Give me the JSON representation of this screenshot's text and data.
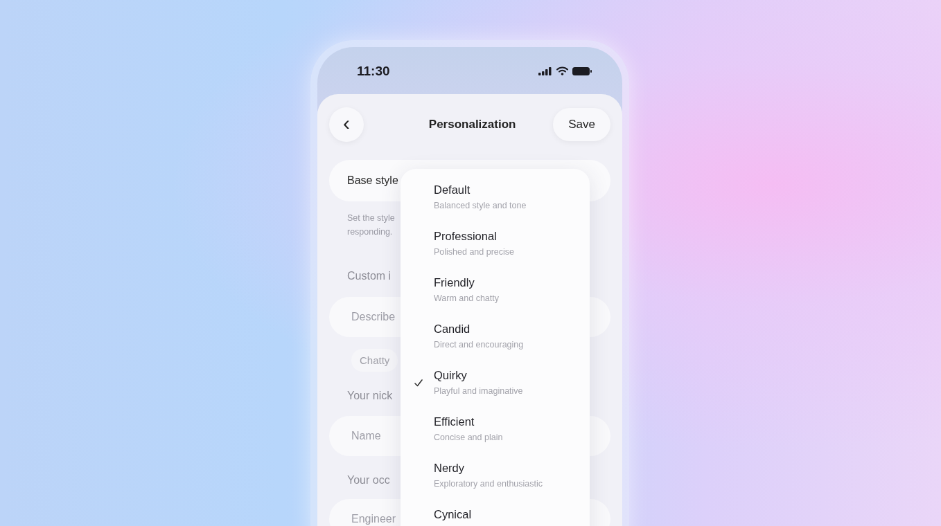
{
  "status_bar": {
    "time": "11:30"
  },
  "header": {
    "back": "‹",
    "title": "Personalization",
    "save": "Save"
  },
  "base_style": {
    "label": "Base style",
    "description": [
      "Set the style",
      "responding."
    ]
  },
  "custom_instructions": {
    "label": "Custom i",
    "placeholder": "Describe",
    "chips": [
      "Chatty"
    ]
  },
  "nickname": {
    "label": "Your nick",
    "placeholder": "Name"
  },
  "occupation": {
    "label": "Your occ",
    "placeholder": "Engineer"
  },
  "dropdown": {
    "items": [
      {
        "title": "Default",
        "subtitle": "Balanced style and tone",
        "selected": false
      },
      {
        "title": "Professional",
        "subtitle": "Polished and precise",
        "selected": false
      },
      {
        "title": "Friendly",
        "subtitle": "Warm and chatty",
        "selected": false
      },
      {
        "title": "Candid",
        "subtitle": "Direct and encouraging",
        "selected": false
      },
      {
        "title": "Quirky",
        "subtitle": "Playful and imaginative",
        "selected": true
      },
      {
        "title": "Efficient",
        "subtitle": "Concise and plain",
        "selected": false
      },
      {
        "title": "Nerdy",
        "subtitle": "Exploratory and enthusiastic",
        "selected": false
      },
      {
        "title": "Cynical",
        "selected": false
      }
    ]
  }
}
